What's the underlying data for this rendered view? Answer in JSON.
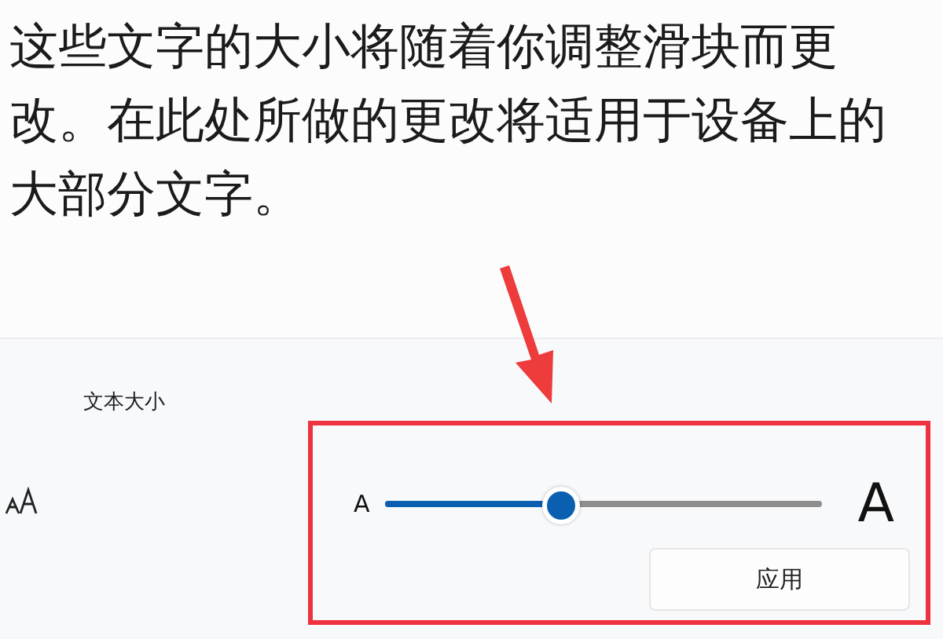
{
  "description": "这些文字的大小将随着你调整滑块而更改。在此处所做的更改将适用于设备上的大部分文字。",
  "text_size": {
    "label": "文本大小",
    "slider": {
      "min_label": "A",
      "max_label": "A",
      "level": 0.4
    },
    "apply_button": "应用"
  },
  "annotation": {
    "highlighted": true
  }
}
